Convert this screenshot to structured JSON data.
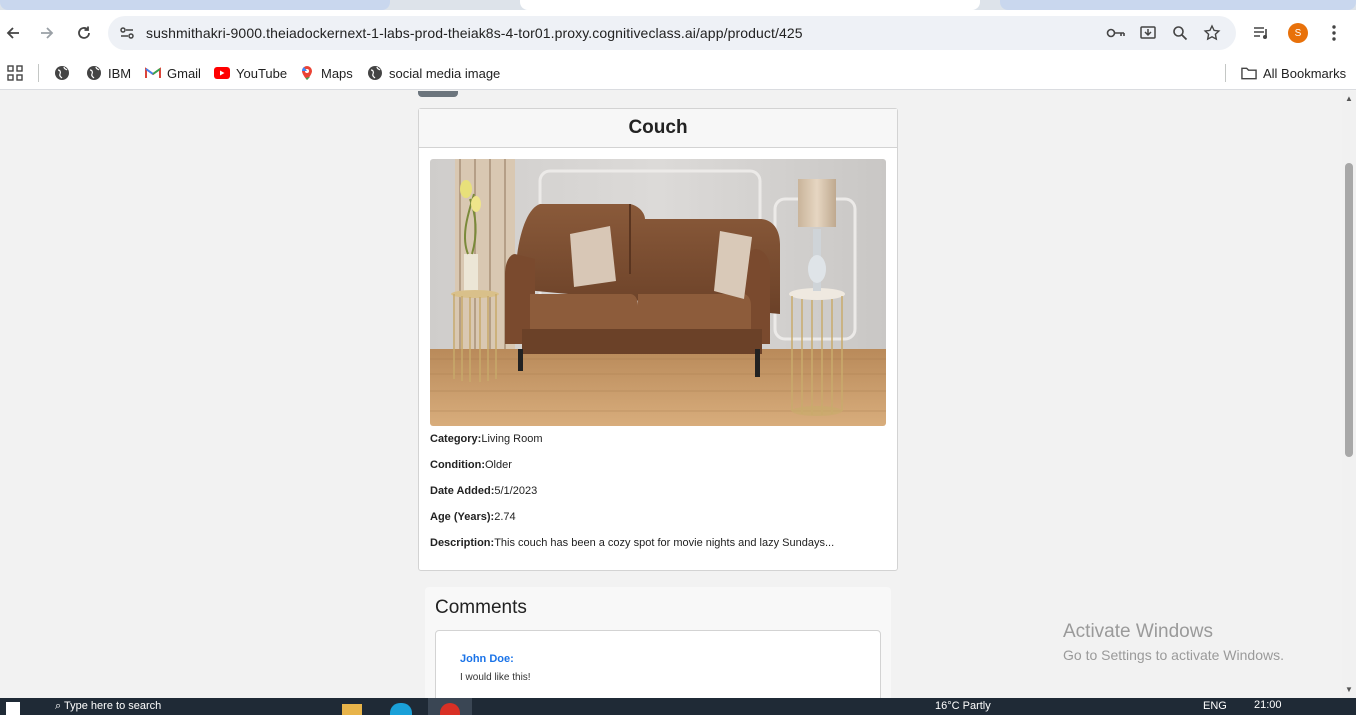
{
  "browser": {
    "url": "sushmithakri-9000.theiadockernext-1-labs-prod-theiak8s-4-tor01.proxy.cognitiveclass.ai/app/product/425",
    "profile_initial": "S",
    "bookmarks": [
      {
        "label": "",
        "icon": "globe-icon"
      },
      {
        "label": "IBM",
        "icon": "globe-icon"
      },
      {
        "label": "Gmail",
        "icon": "gmail-icon"
      },
      {
        "label": "YouTube",
        "icon": "youtube-icon"
      },
      {
        "label": "Maps",
        "icon": "maps-icon"
      },
      {
        "label": "social media image",
        "icon": "globe-icon"
      }
    ],
    "all_bookmarks_label": "All Bookmarks"
  },
  "product": {
    "title": "Couch",
    "image_alt": "Brown leather couch",
    "details": [
      {
        "label": "Category:",
        "value": "Living Room"
      },
      {
        "label": "Condition:",
        "value": "Older"
      },
      {
        "label": "Date Added:",
        "value": "5/1/2023"
      },
      {
        "label": "Age (Years):",
        "value": "2.74"
      },
      {
        "label": "Description:",
        "value": "This couch has been a cozy spot for movie nights and lazy Sundays..."
      }
    ]
  },
  "comments": {
    "heading": "Comments",
    "items": [
      {
        "author": "John Doe:",
        "text": "I would like this!"
      }
    ]
  },
  "watermark": {
    "line1": "Activate Windows",
    "line2": "Go to Settings to activate Windows."
  },
  "taskbar": {
    "search_placeholder": "Type here to search",
    "weather": "16°C  Partly",
    "lang": "ENG",
    "time": "21:00"
  }
}
